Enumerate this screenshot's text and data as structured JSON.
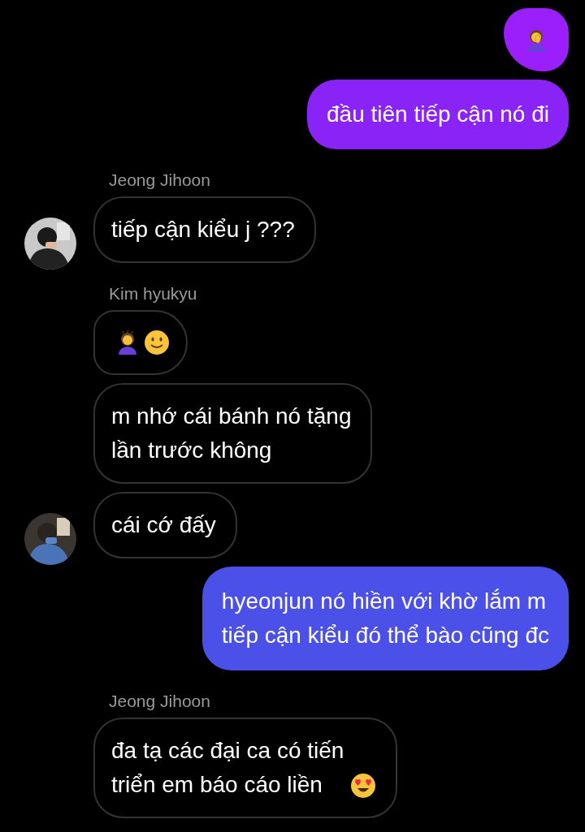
{
  "messages": [
    {
      "kind": "sent",
      "color": "#9a1ffb",
      "parts": [
        {
          "kind": "facepalm"
        }
      ]
    },
    {
      "kind": "sent",
      "color": "#8a24f6",
      "lines": [
        "đầu tiên tiếp cận nó đi"
      ]
    },
    {
      "kind": "received",
      "sender": "Jeong Jihoon",
      "avatar": true,
      "lines": [
        "tiếp cận kiểu j ???"
      ]
    },
    {
      "kind": "received",
      "sender": "Kim hyukyu",
      "avatar": false,
      "parts": [
        {
          "kind": "bowing"
        },
        {
          "kind": "smile"
        }
      ]
    },
    {
      "kind": "received",
      "avatar": false,
      "lines": [
        "m nhớ cái bánh nó tặng",
        "lần trước không"
      ]
    },
    {
      "kind": "received",
      "avatar": true,
      "lines": [
        "cái cớ đấy"
      ]
    },
    {
      "kind": "sent",
      "color": "#4b50e8",
      "lines": [
        "hyeonjun nó hiền với khờ lắm m",
        "tiếp cận kiểu đó thể bào cũng đc"
      ]
    },
    {
      "kind": "received",
      "sender": "Jeong Jihoon",
      "avatar": false,
      "lines": [
        "đa tạ các đại ca có tiến",
        "triển em báo cáo liền"
      ],
      "parts": [
        {
          "kind": "heart_eyes"
        }
      ]
    }
  ]
}
